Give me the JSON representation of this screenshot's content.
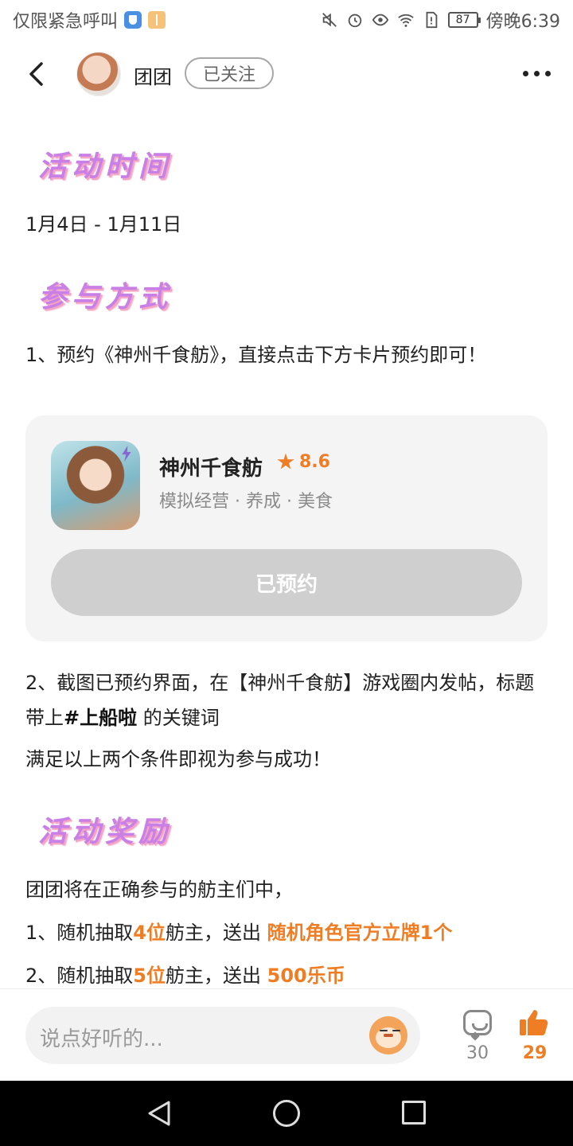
{
  "status_bar": {
    "left_text": "仅限紧急呼叫",
    "battery": "87",
    "time": "傍晚6:39"
  },
  "header": {
    "author_name": "团团",
    "follow_label": "已关注"
  },
  "sections": {
    "time_title": "活动时间",
    "time_value": "1月4日 - 1月11日",
    "method_title": "参与方式",
    "method_step1": "1、预约《神州千食舫》，直接点击下方卡片预约即可！",
    "method_step2_prefix": "2、截图已预约界面，在【神州千食舫】游戏圈内发帖，标题带上",
    "method_step2_keyword": "#上船啦",
    "method_step2_suffix": " 的关键词",
    "method_conclusion": "满足以上两个条件即视为参与成功！",
    "reward_title": "活动奖励",
    "reward_intro": "团团将在正确参与的舫主们中，",
    "reward1_prefix": "1、随机抽取",
    "reward1_count": "4位",
    "reward1_mid": "舫主，送出 ",
    "reward1_prize": "随机角色官方立牌1个",
    "reward2_prefix": "2、随机抽取",
    "reward2_count": "5位",
    "reward2_mid": "舫主，送出 ",
    "reward2_prize": "500乐币"
  },
  "game_card": {
    "name": "神州千食舫",
    "rating": "8.6",
    "tags": "模拟经营 · 养成 · 美食",
    "button_label": "已预约"
  },
  "bottom_bar": {
    "comment_placeholder": "说点好听的...",
    "comment_count": "30",
    "like_count": "29"
  },
  "colors": {
    "accent": "#ee7d24",
    "title_purple": "#c980e6",
    "card_bg": "#f4f4f4",
    "button_disabled": "#cfcfcf"
  }
}
